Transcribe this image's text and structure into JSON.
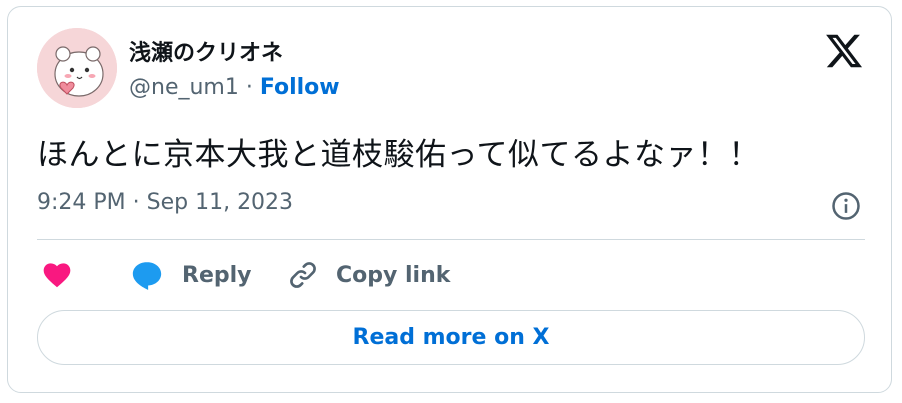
{
  "author": {
    "display_name": "浅瀬のクリオネ",
    "handle": "@ne_um1",
    "separator": " · ",
    "follow_label": "Follow"
  },
  "tweet": {
    "text": "ほんとに京本大我と道枝駿佑って似てるよなァ！！",
    "timestamp": "9:24 PM · Sep 11, 2023"
  },
  "actions": {
    "like_icon": "heart-icon",
    "reply_label": "Reply",
    "copy_link_label": "Copy link"
  },
  "footer": {
    "read_more_label": "Read more on X"
  },
  "colors": {
    "like": "#f91880",
    "reply": "#1d9bf0",
    "link": "#006fd6",
    "text": "#0f1419",
    "muted": "#536471",
    "border": "#cfd9de",
    "avatar_bg": "#f6d6d8"
  }
}
